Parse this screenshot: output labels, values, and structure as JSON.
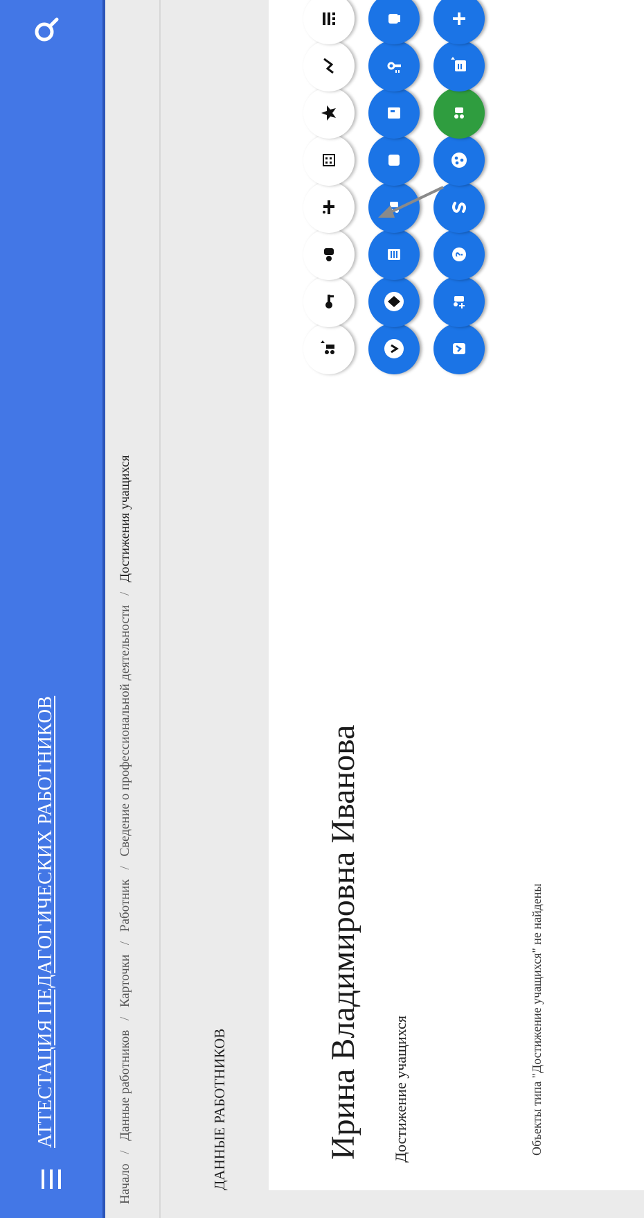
{
  "app": {
    "title": "АТТЕСТАЦИЯ ПЕДАГОГИЧЕСКИХ РАБОТНИКОВ"
  },
  "breadcrumb": [
    {
      "label": "Начало"
    },
    {
      "label": "Данные работников"
    },
    {
      "label": "Карточки"
    },
    {
      "label": "Работник"
    },
    {
      "label": "Сведение о профессиональной деятельности"
    },
    {
      "label": "Достижения учащихся"
    }
  ],
  "section": {
    "title": "ДАННЫЕ РАБОТНИКОВ"
  },
  "person": {
    "name": "Ирина Владимировна Иванова",
    "subtitle": "Достижение учащихся",
    "empty_message": "Объекты типа \"Достижение учащихся\" не найдены"
  },
  "icons": {
    "row1_white": [
      "grid-icon",
      "chart-icon",
      "star-icon",
      "building-icon",
      "tools-icon",
      "person-icon",
      "key-icon",
      "users-play-icon"
    ],
    "row2_blue": [
      "hand-icon",
      "route-icon",
      "card-icon",
      "folder-icon",
      "group-icon",
      "document-icon",
      "diamond-icon",
      "dollar-icon"
    ],
    "row3_blue": [
      "add-icon",
      "play-document-icon",
      "students-icon",
      "ball-icon",
      "s-icon",
      "question-icon",
      "add-user-icon",
      "check-icon"
    ],
    "highlighted": "students-icon",
    "colors": {
      "blue": "#1b74e6",
      "green": "#2f9d3f",
      "header": "#4377e6"
    }
  }
}
